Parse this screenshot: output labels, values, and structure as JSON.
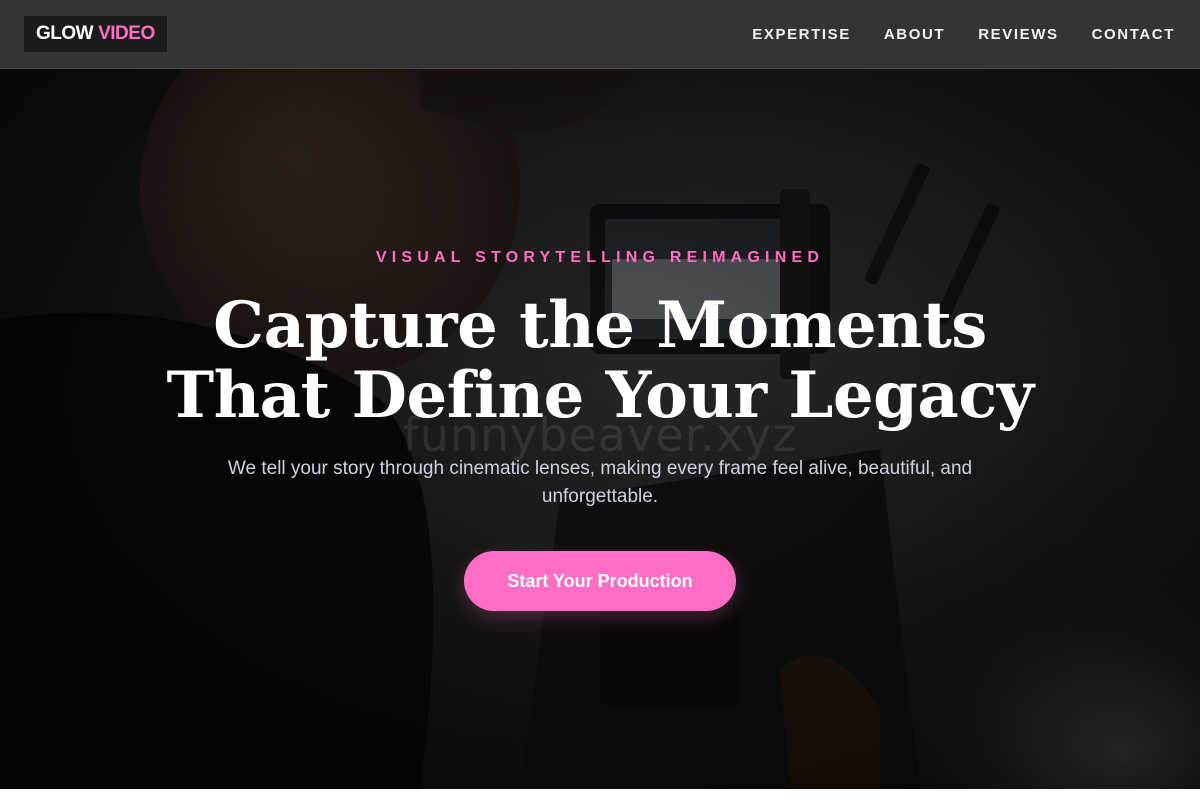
{
  "brand": {
    "logo_part1": "GLOW",
    "logo_part2": "VIDEO",
    "accent_color": "#ff6ec4"
  },
  "nav": {
    "items": [
      {
        "label": "EXPERTISE"
      },
      {
        "label": "ABOUT"
      },
      {
        "label": "REVIEWS"
      },
      {
        "label": "CONTACT"
      }
    ]
  },
  "hero": {
    "eyebrow": "VISUAL STORYTELLING REIMAGINED",
    "headline_line1": "Capture the Moments",
    "headline_line2": "That Define Your Legacy",
    "subtext": "We tell your story through cinematic lenses, making every frame feel alive, beautiful, and unforgettable.",
    "cta_label": "Start Your Production",
    "watermark": "funnybeaver.xyz",
    "background_image": "camera-operator-photo"
  }
}
